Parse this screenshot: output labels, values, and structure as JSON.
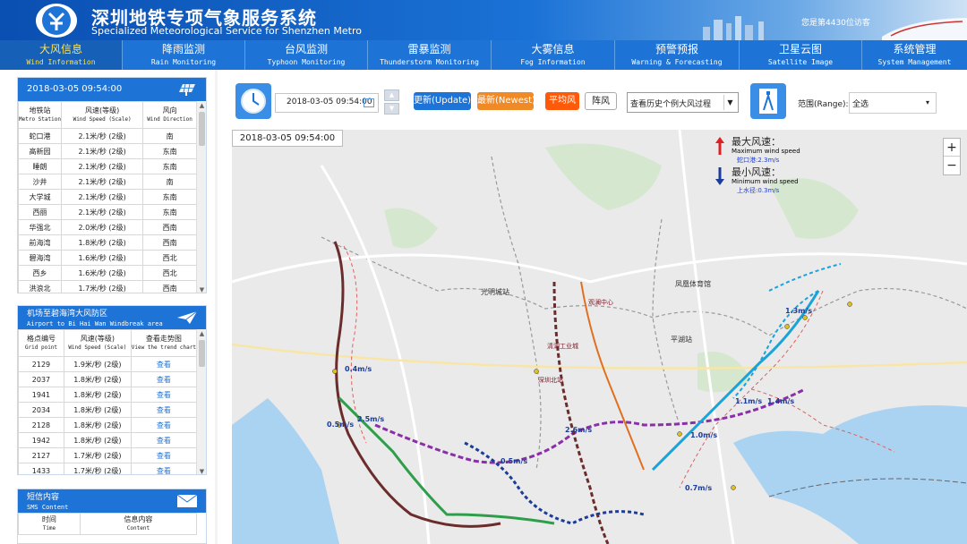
{
  "header": {
    "title_cn": "深圳地铁专项气象服务系统",
    "title_en": "Specialized Meteorological Service for Shenzhen Metro",
    "visitor": "您是第4430位访客"
  },
  "nav": [
    {
      "cn": "大风信息",
      "en": "Wind Information",
      "active": true
    },
    {
      "cn": "降雨监测",
      "en": "Rain Monitoring"
    },
    {
      "cn": "台风监测",
      "en": "Typhoon Monitoring"
    },
    {
      "cn": "雷暴监测",
      "en": "Thunderstorm Monitoring"
    },
    {
      "cn": "大雾信息",
      "en": "Fog Information"
    },
    {
      "cn": "预警预报",
      "en": "Warning & Forecasting"
    },
    {
      "cn": "卫星云图",
      "en": "Satellite Image"
    },
    {
      "cn": "系统管理",
      "en": "System Management"
    }
  ],
  "station_panel": {
    "datetime": "2018-03-05 09:54:00",
    "headers": [
      {
        "cn": "地铁站",
        "en": "Metro Station"
      },
      {
        "cn": "风速(等级)",
        "en": "Wind Speed (Scale)"
      },
      {
        "cn": "风向",
        "en": "Wind Direction"
      }
    ],
    "rows": [
      [
        "蛇口港",
        "2.1米/秒 (2级)",
        "南"
      ],
      [
        "高新园",
        "2.1米/秒 (2级)",
        "东南"
      ],
      [
        "睡朗",
        "2.1米/秒 (2级)",
        "东南"
      ],
      [
        "沙井",
        "2.1米/秒 (2级)",
        "南"
      ],
      [
        "大学城",
        "2.1米/秒 (2级)",
        "东南"
      ],
      [
        "西丽",
        "2.1米/秒 (2级)",
        "东南"
      ],
      [
        "华强北",
        "2.0米/秒 (2级)",
        "西南"
      ],
      [
        "前海湾",
        "1.8米/秒 (2级)",
        "西南"
      ],
      [
        "碧海湾",
        "1.6米/秒 (2级)",
        "西北"
      ],
      [
        "西乡",
        "1.6米/秒 (2级)",
        "西北"
      ],
      [
        "洪浪北",
        "1.7米/秒 (2级)",
        "西南"
      ]
    ]
  },
  "windbreak_panel": {
    "title_cn": "机场至碧海湾大风防区",
    "title_en": "Airport to Bi Hai Wan Windbreak area",
    "headers": [
      {
        "cn": "格点编号",
        "en": "Grid point"
      },
      {
        "cn": "风速(等级)",
        "en": "Wind Speed (Scale)"
      },
      {
        "cn": "查看走势图",
        "en": "View the trend chart"
      }
    ],
    "rows": [
      [
        "2129",
        "1.9米/秒 (2级)",
        "查看"
      ],
      [
        "2037",
        "1.8米/秒 (2级)",
        "查看"
      ],
      [
        "1941",
        "1.8米/秒 (2级)",
        "查看"
      ],
      [
        "2034",
        "1.8米/秒 (2级)",
        "查看"
      ],
      [
        "2128",
        "1.8米/秒 (2级)",
        "查看"
      ],
      [
        "1942",
        "1.8米/秒 (2级)",
        "查看"
      ],
      [
        "2127",
        "1.7米/秒 (2级)",
        "查看"
      ],
      [
        "1433",
        "1.7米/秒 (2级)",
        "查看"
      ]
    ]
  },
  "sms_panel": {
    "title_cn": "短信内容",
    "title_en": "SMS Content",
    "headers": [
      {
        "cn": "时间",
        "en": "Time"
      },
      {
        "cn": "信息内容",
        "en": "Content"
      }
    ]
  },
  "toolbar": {
    "datetime_value": "2018-03-05 09:54:00",
    "update_label": "更新(Update)",
    "newest_label": "最新(Newest)",
    "avg_wind_label": "平均风",
    "gust_label": "阵风",
    "history_select": "查看历史个例大风过程",
    "range_label": "范围(Range):",
    "range_value": "全选"
  },
  "map": {
    "time_label": "2018-03-05 09:54:00",
    "max_title": "最大风速：",
    "max_en": "Maximum wind speed",
    "max_station": "蛇口港:2.3m/s",
    "min_title": "最小风速：",
    "min_en": "Minimum wind speed",
    "min_station": "上水径:0.3m/s",
    "zoom_in": "+",
    "zoom_out": "−",
    "places": [
      {
        "label": "光明城站"
      },
      {
        "label": "凤凰体育馆"
      },
      {
        "label": "平湖站"
      },
      {
        "label": "观澜中心"
      },
      {
        "label": "清湖工业城"
      },
      {
        "label": "深圳北站"
      }
    ],
    "wind_labels": [
      "0.4m/s",
      "2.5m/s",
      "0.5m/s",
      "2.6m/s",
      "1.1m/s",
      "1.4m/s",
      "1.0m/s",
      "0.7m/s",
      "1.3m/s",
      "0.5m/s"
    ]
  },
  "colors": {
    "brand": "#1e73d6",
    "update_btn": "#1e73d6",
    "newest_btn": "#f08a26",
    "avg_wind_btn": "#ff5a0a",
    "line_brown": "#6b2c2c",
    "line_green": "#2e9e4a",
    "line_cyan": "#1ba3d9",
    "line_purple": "#8a2fa8",
    "line_navy": "#1c3c9a"
  }
}
